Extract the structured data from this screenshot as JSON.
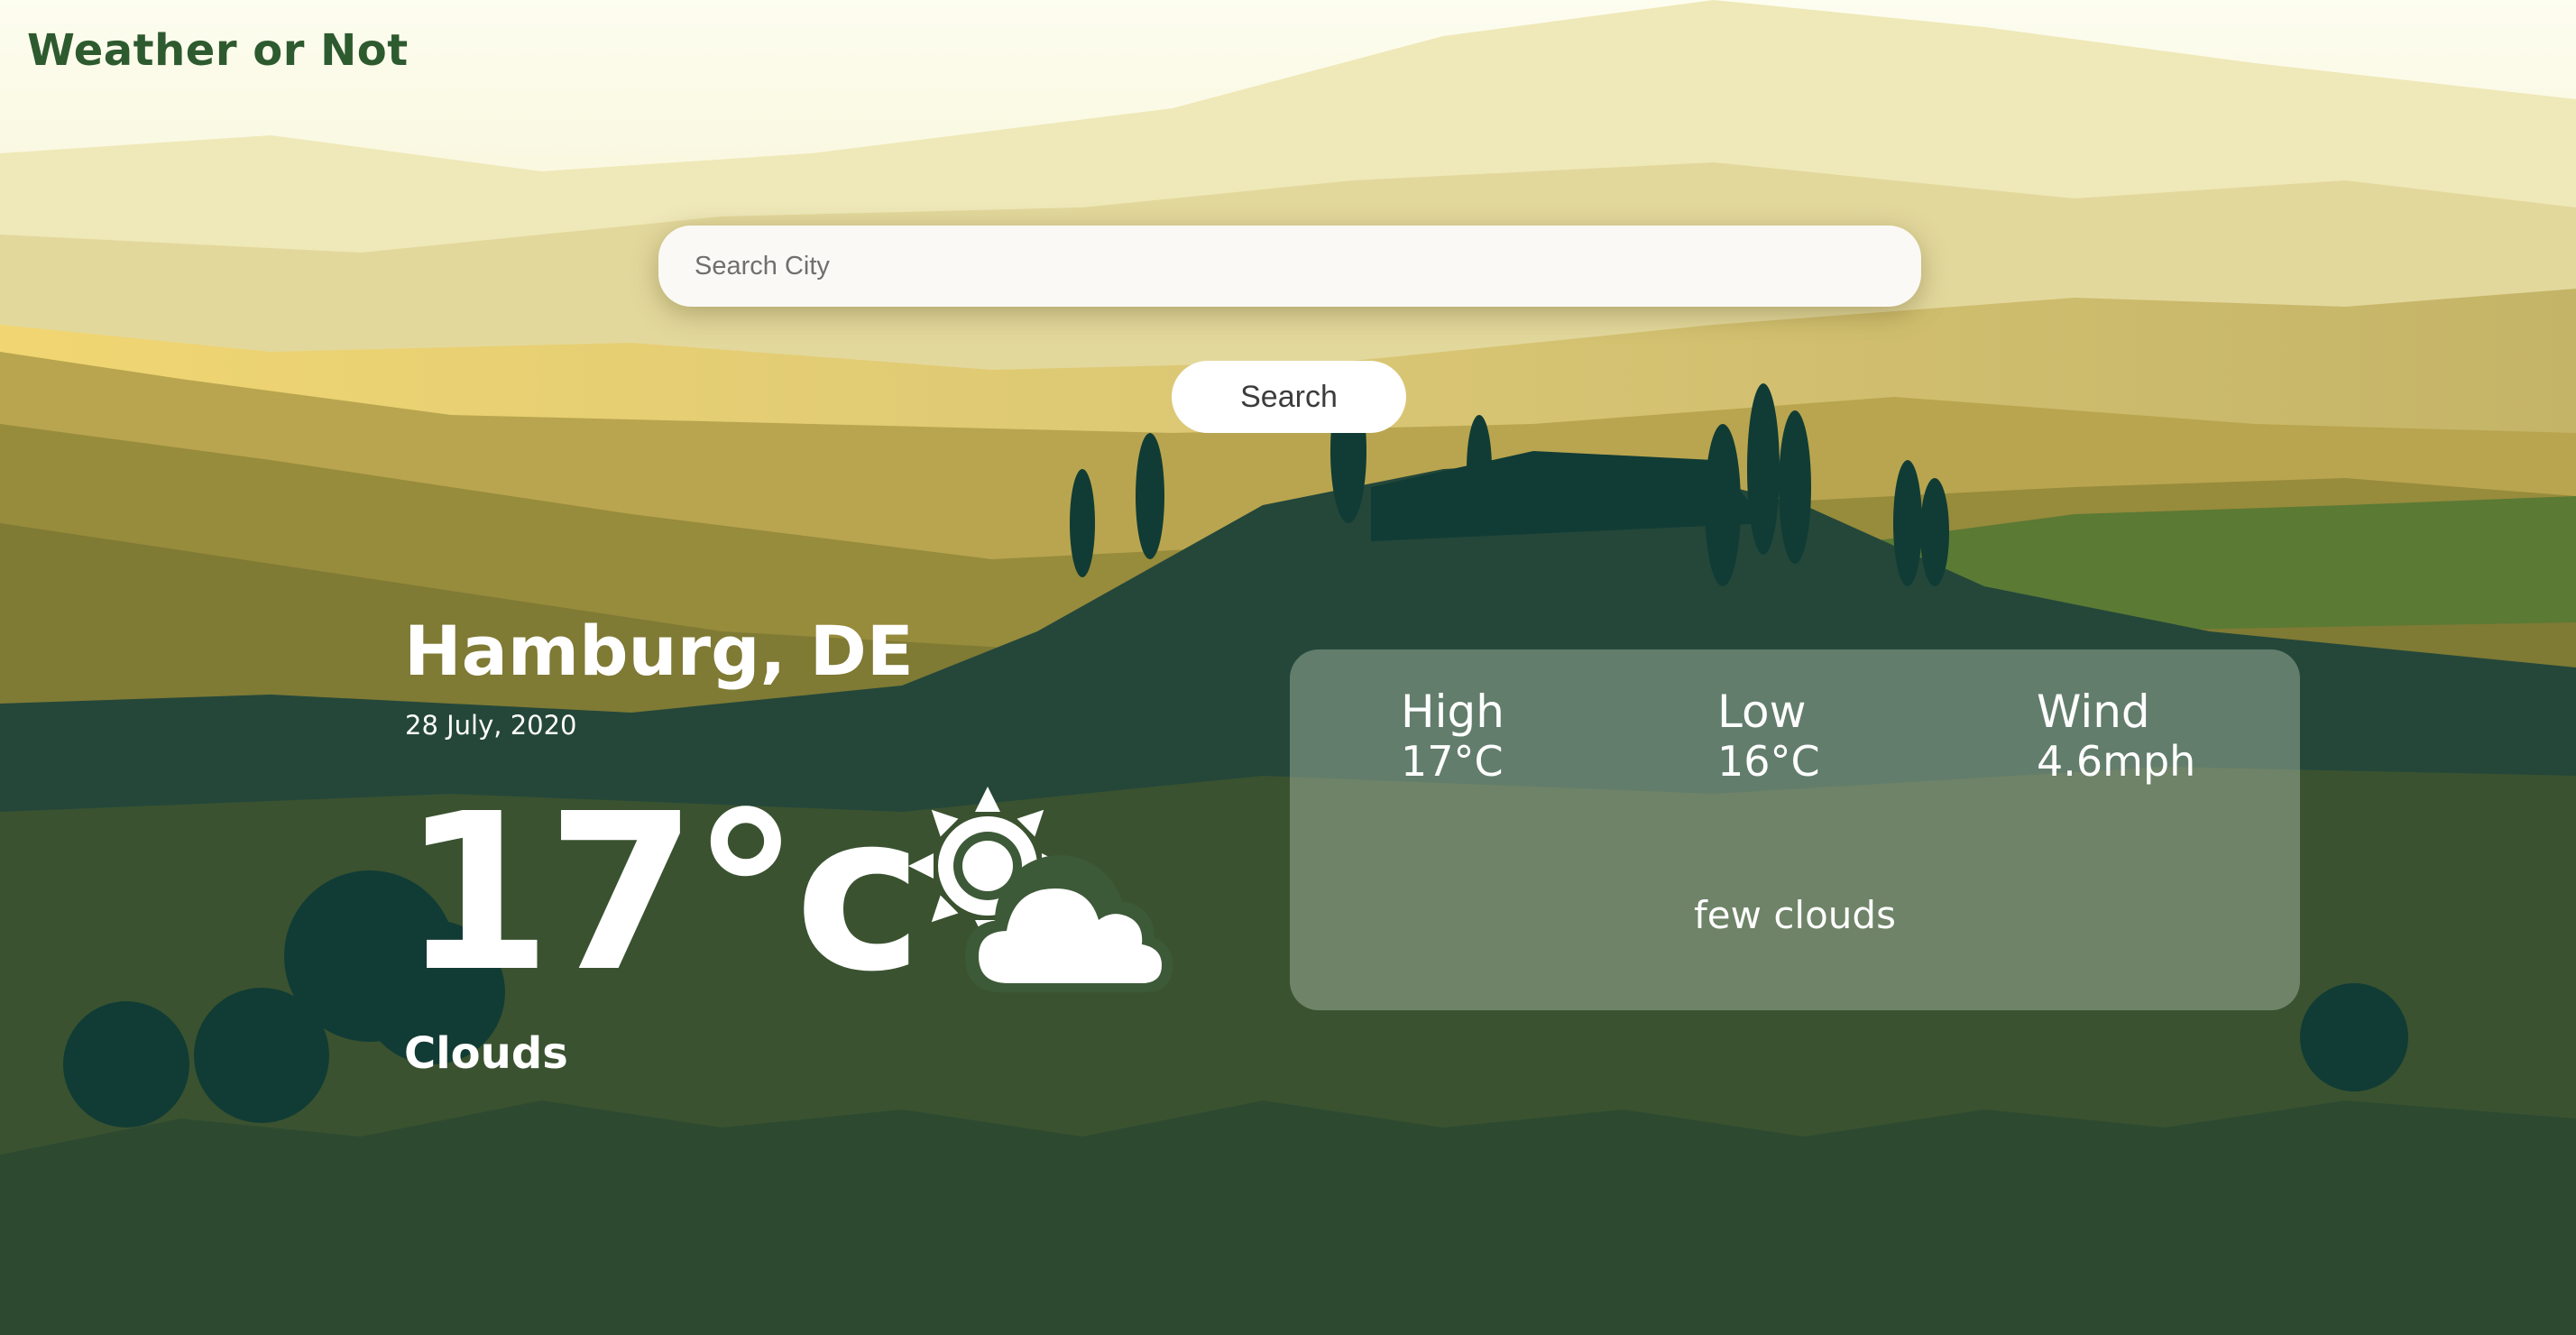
{
  "app": {
    "title": "Weather or Not"
  },
  "search": {
    "placeholder": "Search City",
    "value": "",
    "button_label": "Search"
  },
  "weather": {
    "location": "Hamburg, DE",
    "date": "28 July, 2020",
    "temperature": "17°c",
    "condition": "Clouds",
    "icon": "sun-behind-cloud-icon",
    "description": "few clouds"
  },
  "details": [
    {
      "label": "High",
      "value": "17°C"
    },
    {
      "label": "Low",
      "value": "16°C"
    },
    {
      "label": "Wind",
      "value": "4.6mph"
    }
  ]
}
